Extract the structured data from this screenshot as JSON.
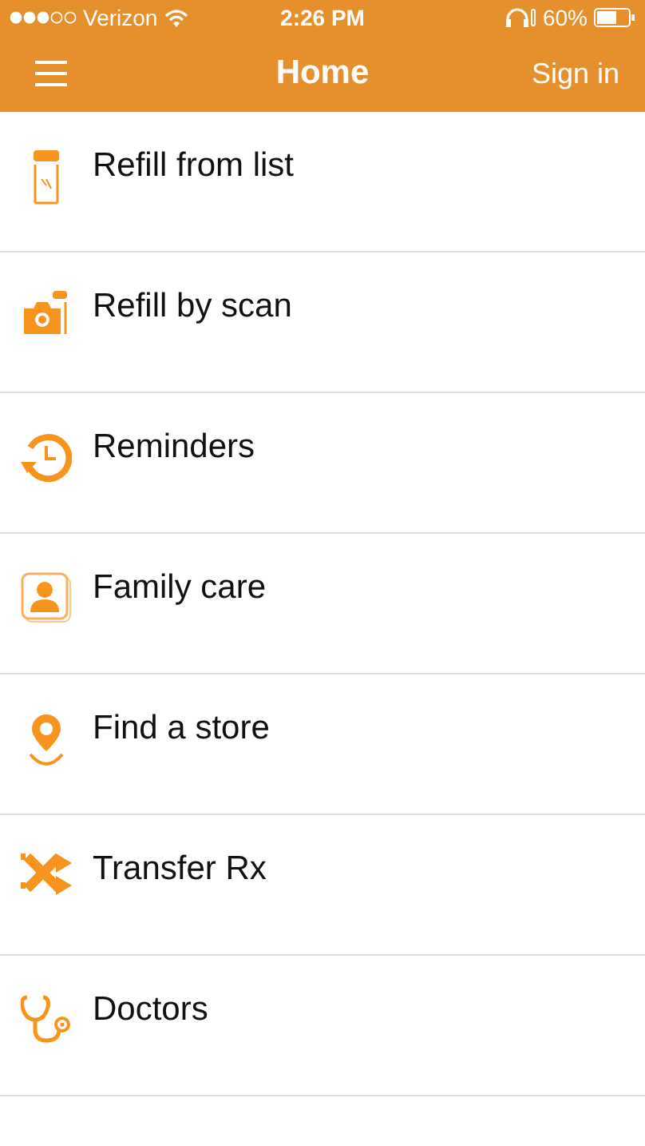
{
  "status_bar": {
    "carrier": "Verizon",
    "time": "2:26 PM",
    "battery": "60%"
  },
  "nav": {
    "title": "Home",
    "action": "Sign in"
  },
  "menu": [
    {
      "kind": "bottle",
      "label": "Refill from list"
    },
    {
      "kind": "camera",
      "label": "Refill by scan"
    },
    {
      "kind": "clock",
      "label": "Reminders"
    },
    {
      "kind": "person",
      "label": "Family care"
    },
    {
      "kind": "pin",
      "label": "Find a store"
    },
    {
      "kind": "transfer",
      "label": "Transfer Rx"
    },
    {
      "kind": "stethoscope",
      "label": "Doctors"
    }
  ]
}
